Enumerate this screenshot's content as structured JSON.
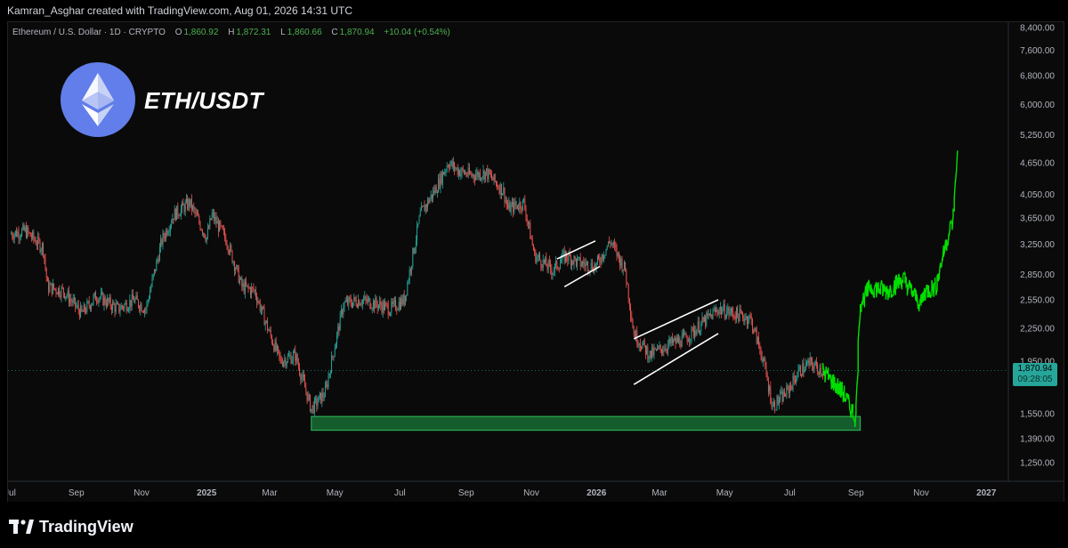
{
  "header": {
    "attribution": "Kamran_Asghar created with TradingView.com, Aug 01, 2026 14:31 UTC"
  },
  "legend": {
    "symbol": "Ethereum / U.S. Dollar · 1D · CRYPTO",
    "open_label": "O",
    "open": "1,860.92",
    "high_label": "H",
    "high": "1,872.31",
    "low_label": "L",
    "low": "1,860.66",
    "close_label": "C",
    "close": "1,870.94",
    "change": "+10.04 (+0.54%)"
  },
  "overlay": {
    "pair": "ETH/USDT",
    "logo_icon": "ethereum-icon"
  },
  "price_tag": {
    "price": "1,870.94",
    "countdown": "09:28:05"
  },
  "footer": {
    "brand": "TradingView",
    "brand_icon": "tradingview-logo-icon"
  },
  "colors": {
    "up": "#26a69a",
    "down": "#ef5350",
    "projection": "#00e000",
    "support_zone": "#1b7a3a",
    "logo_circle": "#627eea"
  },
  "chart_data": {
    "type": "line",
    "title": "",
    "xlabel": "",
    "ylabel": "",
    "y_scale": "log",
    "ylim": [
      1100,
      8800
    ],
    "grid": false,
    "y_ticks": [
      "8,400.00",
      "7,600.00",
      "6,800.00",
      "6,000.00",
      "5,250.00",
      "4,650.00",
      "4,050.00",
      "3,650.00",
      "3,250.00",
      "2,850.00",
      "2,550.00",
      "2,250.00",
      "1,950.00",
      "1,550.00",
      "1,390.00",
      "1,250.00"
    ],
    "y_tick_values": [
      8400,
      7600,
      6800,
      6000,
      5250,
      4650,
      4050,
      3650,
      3250,
      2850,
      2550,
      2250,
      1950,
      1550,
      1390,
      1250
    ],
    "x_ticks": [
      "Jul",
      "Sep",
      "Nov",
      "2025",
      "Mar",
      "May",
      "Jul",
      "Sep",
      "Nov",
      "2026",
      "Mar",
      "May",
      "Jul",
      "Sep",
      "Nov",
      "2027"
    ],
    "x_tick_dates": [
      "2024-07-01",
      "2024-09-01",
      "2024-11-01",
      "2025-01-01",
      "2025-03-01",
      "2025-05-01",
      "2025-07-01",
      "2025-09-01",
      "2025-11-01",
      "2026-01-01",
      "2026-03-01",
      "2026-05-01",
      "2026-07-01",
      "2026-09-01",
      "2026-11-01",
      "2027-01-01"
    ],
    "x_tick_bold": [
      "2025",
      "2026",
      "2027"
    ],
    "series": [
      {
        "style": "candles-approx",
        "x": [
          "2024-07-01",
          "2024-07-15",
          "2024-08-01",
          "2024-08-05",
          "2024-08-20",
          "2024-09-06",
          "2024-09-20",
          "2024-10-10",
          "2024-10-25",
          "2024-11-05",
          "2024-11-20",
          "2024-12-01",
          "2024-12-16",
          "2025-01-01",
          "2025-01-06",
          "2025-01-20",
          "2025-02-03",
          "2025-02-15",
          "2025-03-01",
          "2025-03-11",
          "2025-03-25",
          "2025-04-09",
          "2025-04-22",
          "2025-05-09",
          "2025-05-25",
          "2025-06-10",
          "2025-06-22",
          "2025-07-05",
          "2025-07-20",
          "2025-08-05",
          "2025-08-15",
          "2025-08-24",
          "2025-09-05",
          "2025-09-20",
          "2025-10-06",
          "2025-10-10",
          "2025-10-25",
          "2025-11-04",
          "2025-11-21",
          "2025-12-03",
          "2025-12-15",
          "2025-12-31",
          "2026-01-14",
          "2026-01-28",
          "2026-02-05",
          "2026-02-20",
          "2026-03-10",
          "2026-03-25",
          "2026-04-10",
          "2026-04-25",
          "2026-05-10",
          "2026-05-25",
          "2026-06-05",
          "2026-06-15",
          "2026-06-28",
          "2026-07-10",
          "2026-07-20",
          "2026-08-01"
        ],
        "values": [
          3400,
          3450,
          3200,
          2700,
          2650,
          2400,
          2600,
          2450,
          2550,
          2450,
          3300,
          3700,
          3900,
          3350,
          3700,
          3300,
          2700,
          2650,
          2200,
          1950,
          2000,
          1580,
          1700,
          2500,
          2550,
          2500,
          2450,
          2550,
          3700,
          4200,
          4650,
          4500,
          4400,
          4450,
          4100,
          3800,
          3900,
          3100,
          2900,
          3100,
          3000,
          2950,
          3300,
          2900,
          2200,
          2000,
          2100,
          2150,
          2300,
          2450,
          2400,
          2350,
          2000,
          1600,
          1700,
          1870,
          1930,
          1870
        ]
      },
      {
        "style": "projection",
        "x": [
          "2026-08-01",
          "2026-08-20",
          "2026-09-01",
          "2026-09-05",
          "2026-09-15",
          "2026-10-01",
          "2026-10-15",
          "2026-11-01",
          "2026-11-05",
          "2026-11-15",
          "2026-11-25",
          "2026-12-01",
          "2026-12-05"
        ],
        "values": [
          1870,
          1700,
          1520,
          2500,
          2700,
          2650,
          2800,
          2500,
          2650,
          2700,
          3300,
          3600,
          4800
        ]
      }
    ],
    "annotations": {
      "support_zone": {
        "low": 1440,
        "high": 1530,
        "from": "2025-04-09",
        "to": "2026-09-05"
      },
      "channels": [
        {
          "upper": [
            [
              "2025-11-25",
              3050
            ],
            [
              "2025-12-31",
              3300
            ]
          ],
          "lower": [
            [
              "2025-12-02",
              2700
            ],
            [
              "2026-01-04",
              2950
            ]
          ]
        },
        {
          "upper": [
            [
              "2026-02-05",
              2150
            ],
            [
              "2026-04-25",
              2550
            ]
          ],
          "lower": [
            [
              "2026-02-05",
              1760
            ],
            [
              "2026-04-25",
              2200
            ]
          ]
        }
      ],
      "last_price": 1870.94
    }
  }
}
